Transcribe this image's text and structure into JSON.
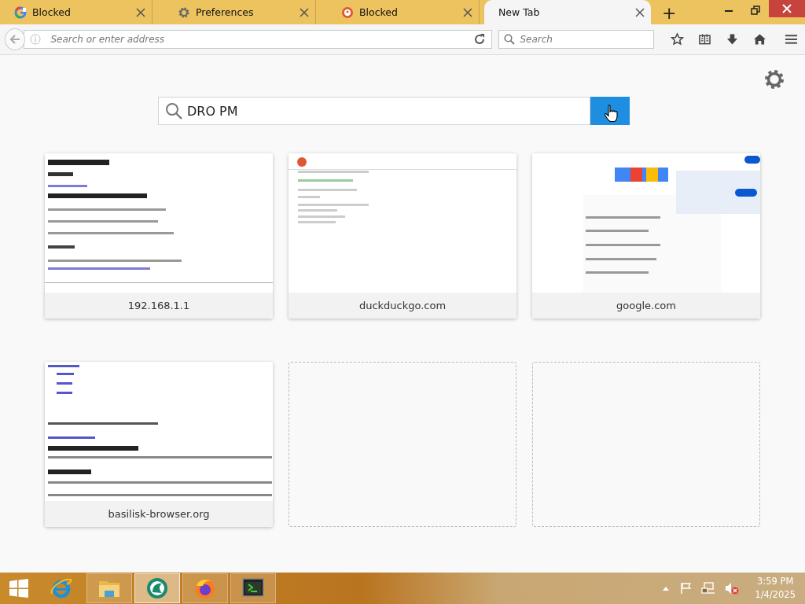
{
  "tabs": [
    {
      "title": "Blocked",
      "kind": "google",
      "selected": false
    },
    {
      "title": "Preferences",
      "kind": "settings",
      "selected": false
    },
    {
      "title": "Blocked",
      "kind": "duck",
      "selected": false
    },
    {
      "title": "New Tab",
      "kind": "blank",
      "selected": true
    }
  ],
  "new_tab_button": "+",
  "toolbar": {
    "address_placeholder": "Search or enter address",
    "search_placeholder": "Search"
  },
  "page_search": {
    "value": "DRO PM"
  },
  "tiles": [
    {
      "kind": "site",
      "label": "192.168.1.1"
    },
    {
      "kind": "site",
      "label": "duckduckgo.com"
    },
    {
      "kind": "site",
      "label": "google.com"
    },
    {
      "kind": "site",
      "label": "basilisk-browser.org"
    },
    {
      "kind": "empty"
    },
    {
      "kind": "empty"
    }
  ],
  "taskbar": {
    "apps": [
      {
        "kind": "ie",
        "selected": false
      },
      {
        "kind": "folder",
        "selected": false
      },
      {
        "kind": "basilisk",
        "selected": true
      },
      {
        "kind": "firefox",
        "selected": false
      },
      {
        "kind": "terminal",
        "selected": false
      }
    ],
    "clock": {
      "time": "3:59 PM",
      "date": "1/4/2025"
    }
  }
}
